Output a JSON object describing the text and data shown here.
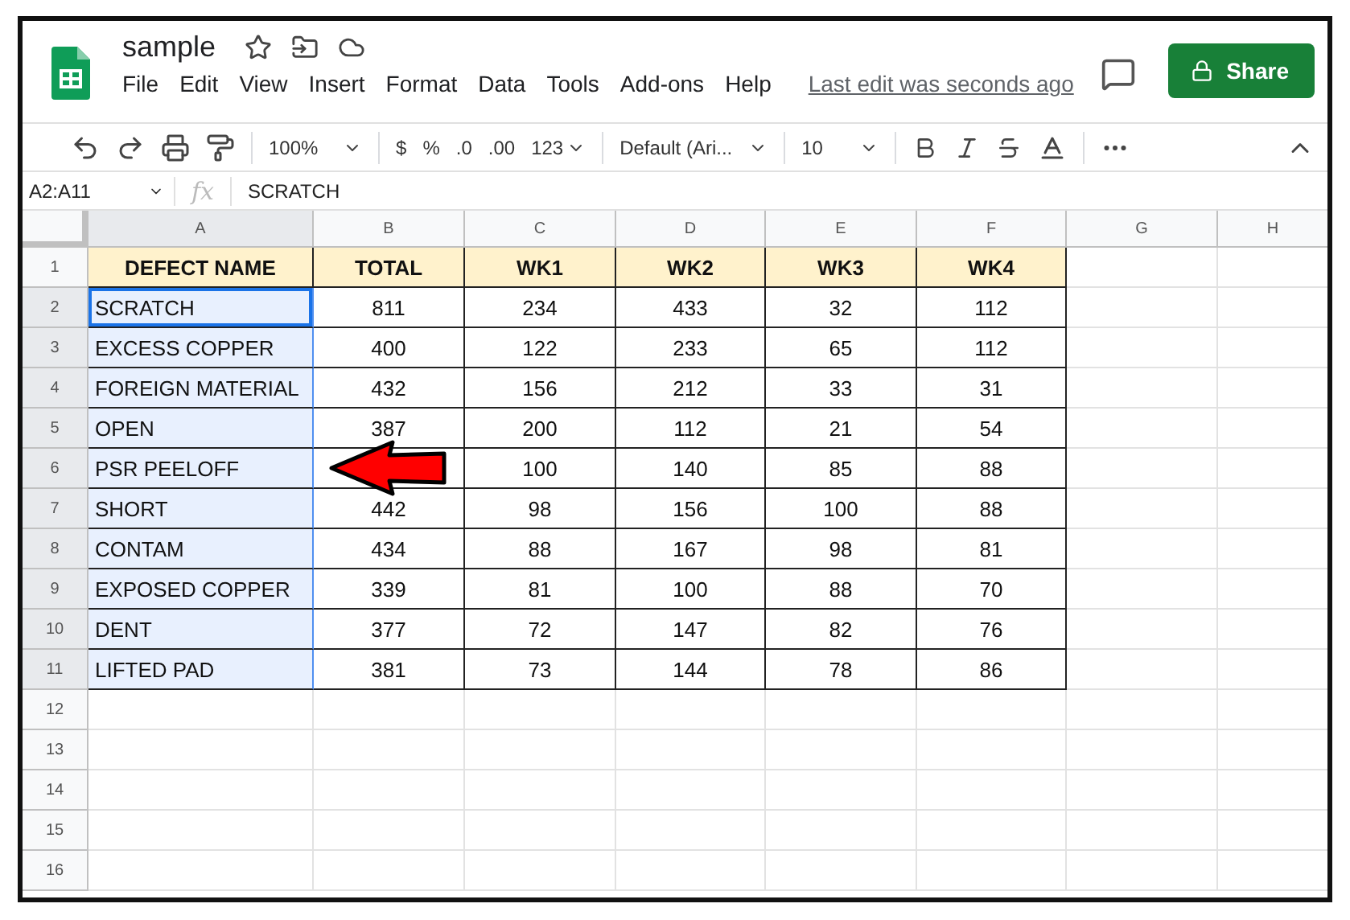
{
  "document": {
    "title": "sample"
  },
  "menu": [
    "File",
    "Edit",
    "View",
    "Insert",
    "Format",
    "Data",
    "Tools",
    "Add-ons",
    "Help"
  ],
  "last_edit": "Last edit was seconds ago",
  "share_button": "Share",
  "toolbar": {
    "zoom": "100%",
    "currency": "$",
    "percent": "%",
    "decimal_decrease": ".0",
    "decimal_increase": ".00",
    "number_format": "123",
    "font": "Default (Ari...",
    "font_size": "10"
  },
  "formula_bar": {
    "name_box": "A2:A11",
    "function_label": "fx",
    "formula": "SCRATCH"
  },
  "sheet": {
    "columns": [
      {
        "label": "A",
        "selected": true
      },
      {
        "label": "B",
        "selected": false
      },
      {
        "label": "C",
        "selected": false
      },
      {
        "label": "D",
        "selected": false
      },
      {
        "label": "E",
        "selected": false
      },
      {
        "label": "F",
        "selected": false
      },
      {
        "label": "G",
        "selected": false
      },
      {
        "label": "H",
        "selected": false
      }
    ],
    "rows": [
      {
        "number": "1",
        "kind": "header",
        "selected": false,
        "active": false,
        "cells": [
          "DEFECT NAME",
          "TOTAL",
          "WK1",
          "WK2",
          "WK3",
          "WK4"
        ]
      },
      {
        "number": "2",
        "kind": "data",
        "selected": true,
        "active": true,
        "cells": [
          "SCRATCH",
          "811",
          "234",
          "433",
          "32",
          "112"
        ]
      },
      {
        "number": "3",
        "kind": "data",
        "selected": true,
        "active": false,
        "cells": [
          "EXCESS COPPER",
          "400",
          "122",
          "233",
          "65",
          "112"
        ]
      },
      {
        "number": "4",
        "kind": "data",
        "selected": true,
        "active": false,
        "cells": [
          "FOREIGN MATERIAL",
          "432",
          "156",
          "212",
          "33",
          "31"
        ]
      },
      {
        "number": "5",
        "kind": "data",
        "selected": true,
        "active": false,
        "cells": [
          "OPEN",
          "387",
          "200",
          "112",
          "21",
          "54"
        ]
      },
      {
        "number": "6",
        "kind": "data",
        "selected": true,
        "active": false,
        "cells": [
          "PSR PEELOFF",
          null,
          "100",
          "140",
          "85",
          "88"
        ]
      },
      {
        "number": "7",
        "kind": "data",
        "selected": true,
        "active": false,
        "cells": [
          "SHORT",
          "442",
          "98",
          "156",
          "100",
          "88"
        ]
      },
      {
        "number": "8",
        "kind": "data",
        "selected": true,
        "active": false,
        "cells": [
          "CONTAM",
          "434",
          "88",
          "167",
          "98",
          "81"
        ]
      },
      {
        "number": "9",
        "kind": "data",
        "selected": true,
        "active": false,
        "cells": [
          "EXPOSED COPPER",
          "339",
          "81",
          "100",
          "88",
          "70"
        ]
      },
      {
        "number": "10",
        "kind": "data",
        "selected": true,
        "active": false,
        "cells": [
          "DENT",
          "377",
          "72",
          "147",
          "82",
          "76"
        ]
      },
      {
        "number": "11",
        "kind": "data",
        "selected": true,
        "active": false,
        "cells": [
          "LIFTED PAD",
          "381",
          "73",
          "144",
          "78",
          "86"
        ]
      },
      {
        "number": "12",
        "kind": "empty",
        "selected": false,
        "active": false,
        "cells": []
      },
      {
        "number": "13",
        "kind": "empty",
        "selected": false,
        "active": false,
        "cells": []
      },
      {
        "number": "14",
        "kind": "empty",
        "selected": false,
        "active": false,
        "cells": []
      },
      {
        "number": "15",
        "kind": "empty",
        "selected": false,
        "active": false,
        "cells": []
      },
      {
        "number": "16",
        "kind": "empty",
        "selected": false,
        "active": false,
        "cells": []
      }
    ]
  }
}
